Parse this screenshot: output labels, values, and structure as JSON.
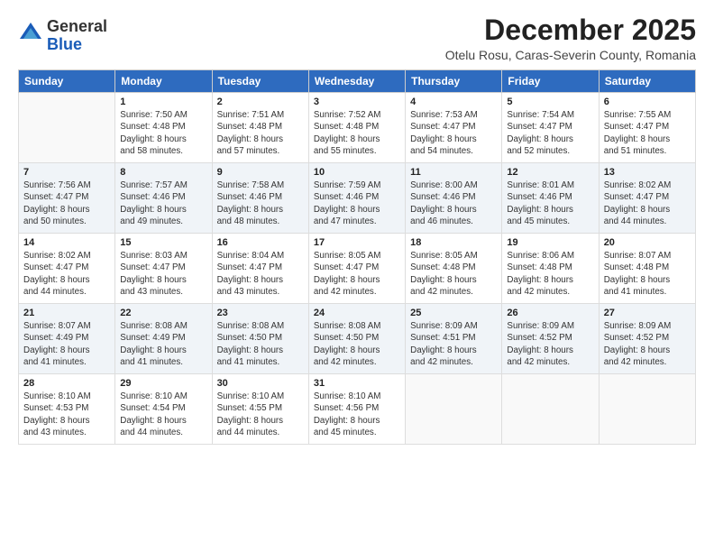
{
  "header": {
    "logo_general": "General",
    "logo_blue": "Blue",
    "month": "December 2025",
    "location": "Otelu Rosu, Caras-Severin County, Romania"
  },
  "weekdays": [
    "Sunday",
    "Monday",
    "Tuesday",
    "Wednesday",
    "Thursday",
    "Friday",
    "Saturday"
  ],
  "weeks": [
    [
      {
        "day": "",
        "info": ""
      },
      {
        "day": "1",
        "info": "Sunrise: 7:50 AM\nSunset: 4:48 PM\nDaylight: 8 hours\nand 58 minutes."
      },
      {
        "day": "2",
        "info": "Sunrise: 7:51 AM\nSunset: 4:48 PM\nDaylight: 8 hours\nand 57 minutes."
      },
      {
        "day": "3",
        "info": "Sunrise: 7:52 AM\nSunset: 4:48 PM\nDaylight: 8 hours\nand 55 minutes."
      },
      {
        "day": "4",
        "info": "Sunrise: 7:53 AM\nSunset: 4:47 PM\nDaylight: 8 hours\nand 54 minutes."
      },
      {
        "day": "5",
        "info": "Sunrise: 7:54 AM\nSunset: 4:47 PM\nDaylight: 8 hours\nand 52 minutes."
      },
      {
        "day": "6",
        "info": "Sunrise: 7:55 AM\nSunset: 4:47 PM\nDaylight: 8 hours\nand 51 minutes."
      }
    ],
    [
      {
        "day": "7",
        "info": "Sunrise: 7:56 AM\nSunset: 4:47 PM\nDaylight: 8 hours\nand 50 minutes."
      },
      {
        "day": "8",
        "info": "Sunrise: 7:57 AM\nSunset: 4:46 PM\nDaylight: 8 hours\nand 49 minutes."
      },
      {
        "day": "9",
        "info": "Sunrise: 7:58 AM\nSunset: 4:46 PM\nDaylight: 8 hours\nand 48 minutes."
      },
      {
        "day": "10",
        "info": "Sunrise: 7:59 AM\nSunset: 4:46 PM\nDaylight: 8 hours\nand 47 minutes."
      },
      {
        "day": "11",
        "info": "Sunrise: 8:00 AM\nSunset: 4:46 PM\nDaylight: 8 hours\nand 46 minutes."
      },
      {
        "day": "12",
        "info": "Sunrise: 8:01 AM\nSunset: 4:46 PM\nDaylight: 8 hours\nand 45 minutes."
      },
      {
        "day": "13",
        "info": "Sunrise: 8:02 AM\nSunset: 4:47 PM\nDaylight: 8 hours\nand 44 minutes."
      }
    ],
    [
      {
        "day": "14",
        "info": "Sunrise: 8:02 AM\nSunset: 4:47 PM\nDaylight: 8 hours\nand 44 minutes."
      },
      {
        "day": "15",
        "info": "Sunrise: 8:03 AM\nSunset: 4:47 PM\nDaylight: 8 hours\nand 43 minutes."
      },
      {
        "day": "16",
        "info": "Sunrise: 8:04 AM\nSunset: 4:47 PM\nDaylight: 8 hours\nand 43 minutes."
      },
      {
        "day": "17",
        "info": "Sunrise: 8:05 AM\nSunset: 4:47 PM\nDaylight: 8 hours\nand 42 minutes."
      },
      {
        "day": "18",
        "info": "Sunrise: 8:05 AM\nSunset: 4:48 PM\nDaylight: 8 hours\nand 42 minutes."
      },
      {
        "day": "19",
        "info": "Sunrise: 8:06 AM\nSunset: 4:48 PM\nDaylight: 8 hours\nand 42 minutes."
      },
      {
        "day": "20",
        "info": "Sunrise: 8:07 AM\nSunset: 4:48 PM\nDaylight: 8 hours\nand 41 minutes."
      }
    ],
    [
      {
        "day": "21",
        "info": "Sunrise: 8:07 AM\nSunset: 4:49 PM\nDaylight: 8 hours\nand 41 minutes."
      },
      {
        "day": "22",
        "info": "Sunrise: 8:08 AM\nSunset: 4:49 PM\nDaylight: 8 hours\nand 41 minutes."
      },
      {
        "day": "23",
        "info": "Sunrise: 8:08 AM\nSunset: 4:50 PM\nDaylight: 8 hours\nand 41 minutes."
      },
      {
        "day": "24",
        "info": "Sunrise: 8:08 AM\nSunset: 4:50 PM\nDaylight: 8 hours\nand 42 minutes."
      },
      {
        "day": "25",
        "info": "Sunrise: 8:09 AM\nSunset: 4:51 PM\nDaylight: 8 hours\nand 42 minutes."
      },
      {
        "day": "26",
        "info": "Sunrise: 8:09 AM\nSunset: 4:52 PM\nDaylight: 8 hours\nand 42 minutes."
      },
      {
        "day": "27",
        "info": "Sunrise: 8:09 AM\nSunset: 4:52 PM\nDaylight: 8 hours\nand 42 minutes."
      }
    ],
    [
      {
        "day": "28",
        "info": "Sunrise: 8:10 AM\nSunset: 4:53 PM\nDaylight: 8 hours\nand 43 minutes."
      },
      {
        "day": "29",
        "info": "Sunrise: 8:10 AM\nSunset: 4:54 PM\nDaylight: 8 hours\nand 44 minutes."
      },
      {
        "day": "30",
        "info": "Sunrise: 8:10 AM\nSunset: 4:55 PM\nDaylight: 8 hours\nand 44 minutes."
      },
      {
        "day": "31",
        "info": "Sunrise: 8:10 AM\nSunset: 4:56 PM\nDaylight: 8 hours\nand 45 minutes."
      },
      {
        "day": "",
        "info": ""
      },
      {
        "day": "",
        "info": ""
      },
      {
        "day": "",
        "info": ""
      }
    ]
  ]
}
